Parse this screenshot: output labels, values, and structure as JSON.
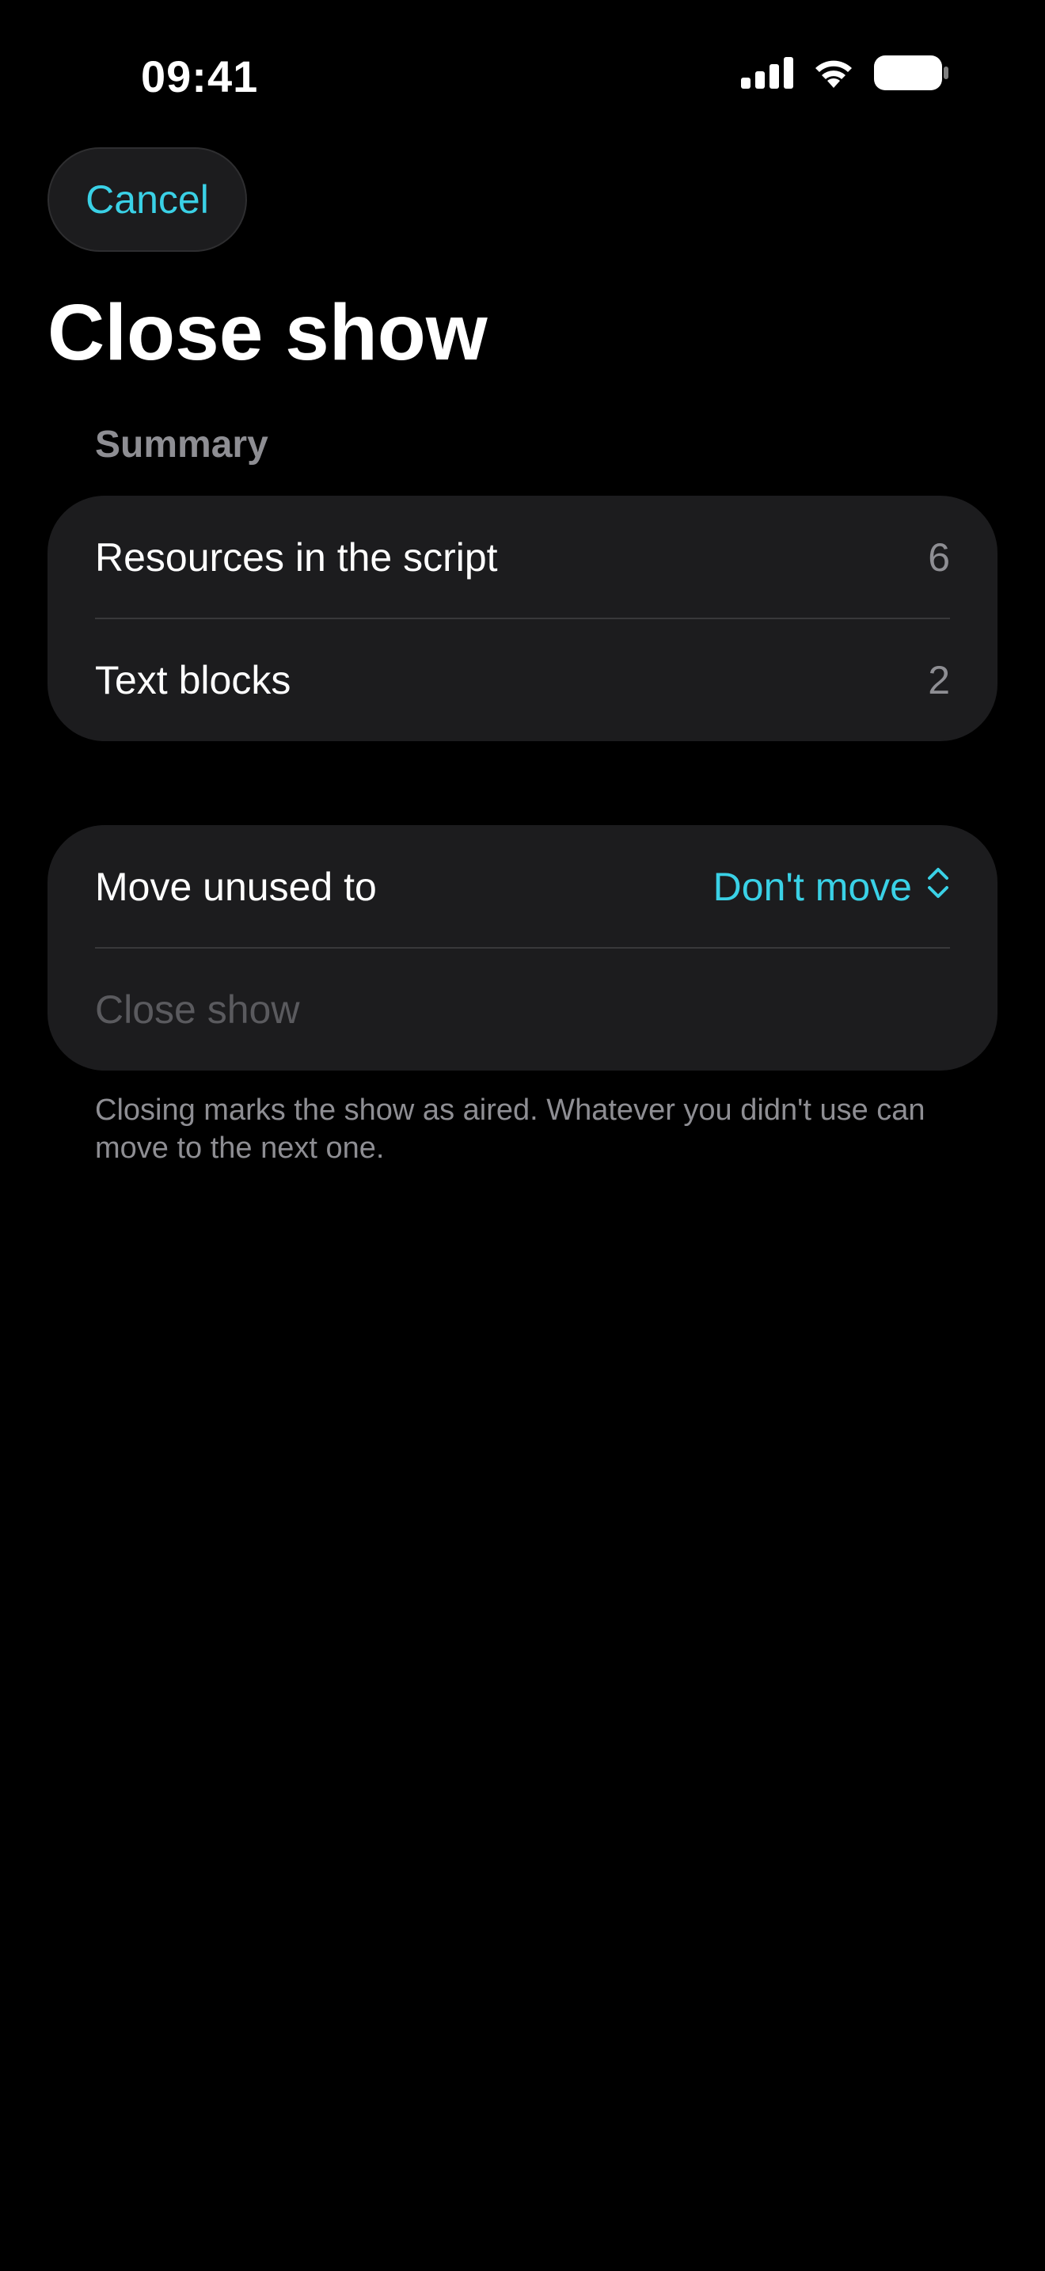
{
  "status_bar": {
    "time": "09:41",
    "icons": [
      "cellular-signal-icon",
      "wifi-icon",
      "battery-icon"
    ]
  },
  "nav": {
    "cancel_label": "Cancel"
  },
  "page": {
    "title": "Close show"
  },
  "summary": {
    "header": "Summary",
    "rows": [
      {
        "label": "Resources in the script",
        "value": "6"
      },
      {
        "label": "Text blocks",
        "value": "2"
      }
    ]
  },
  "move": {
    "label": "Move unused to",
    "selected": "Don't move",
    "action_label": "Close show",
    "footnote": "Closing marks the show as aired. Whatever you didn't use can move to the next one."
  },
  "colors": {
    "accent": "#3ad1e6",
    "background": "#000000",
    "card": "#1c1c1e",
    "secondary_text": "#8e8e93",
    "disabled_text": "#5a5a5e"
  }
}
